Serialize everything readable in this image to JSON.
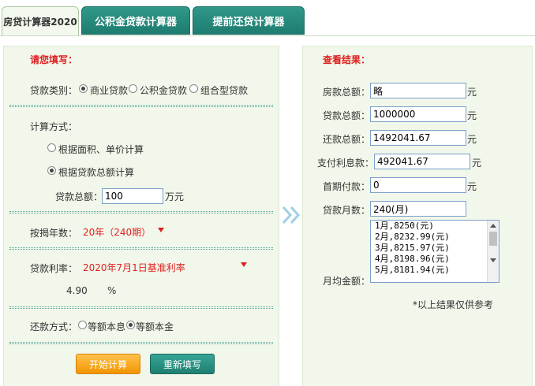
{
  "tabs": [
    {
      "label": "房贷计算器2020",
      "active": true
    },
    {
      "label": "公积金贷款计算器",
      "active": false
    },
    {
      "label": "提前还贷计算器",
      "active": false
    }
  ],
  "form": {
    "heading": "请您填写：",
    "loan_type": {
      "label": "贷款类别：",
      "options": [
        "商业贷款",
        "公积金贷款",
        "组合型贷款"
      ],
      "selected": "商业贷款"
    },
    "calc_method": {
      "label": "计算方式：",
      "options": [
        "根据面积、单价计算",
        "根据贷款总额计算"
      ],
      "selected": "根据贷款总额计算"
    },
    "loan_total": {
      "label": "贷款总额：",
      "value": "100",
      "unit": "万元"
    },
    "term": {
      "label": "按揭年数：",
      "value": "20年（240期）"
    },
    "rate": {
      "label": "贷款利率：",
      "value": "2020年7月1日基准利率",
      "number": "4.90",
      "unit": "%"
    },
    "repay": {
      "label": "还款方式：",
      "options": [
        "等额本息",
        "等额本金"
      ],
      "selected": "等额本金"
    },
    "start_button": "开始计算",
    "reset_button": "重新填写"
  },
  "results": {
    "heading": "查看结果：",
    "house_total": {
      "label": "房款总额：",
      "value": "略",
      "unit": "元"
    },
    "loan_total": {
      "label": "贷款总额：",
      "value": "1000000",
      "unit": "元"
    },
    "repay_total": {
      "label": "还款总额：",
      "value": "1492041.67",
      "unit": "元"
    },
    "interest": {
      "label": "支付利息款：",
      "value": "492041.67",
      "unit": "元"
    },
    "down_payment": {
      "label": "首期付款：",
      "value": "0",
      "unit": "元"
    },
    "months": {
      "label": "贷款月数：",
      "value": "240(月)"
    },
    "monthly": {
      "label": "月均金额：",
      "lines": [
        "1月,8250(元)",
        "2月,8232.99(元)",
        "3月,8215.97(元)",
        "4月,8198.96(元)",
        "5月,8181.94(元)"
      ]
    },
    "note": "*以上结果仅供参考"
  },
  "colors": {
    "accent_red": "#e02020",
    "tab_teal": "#1e7c70",
    "button_orange": "#f29400",
    "panel_bg": "#f1f7ea"
  }
}
